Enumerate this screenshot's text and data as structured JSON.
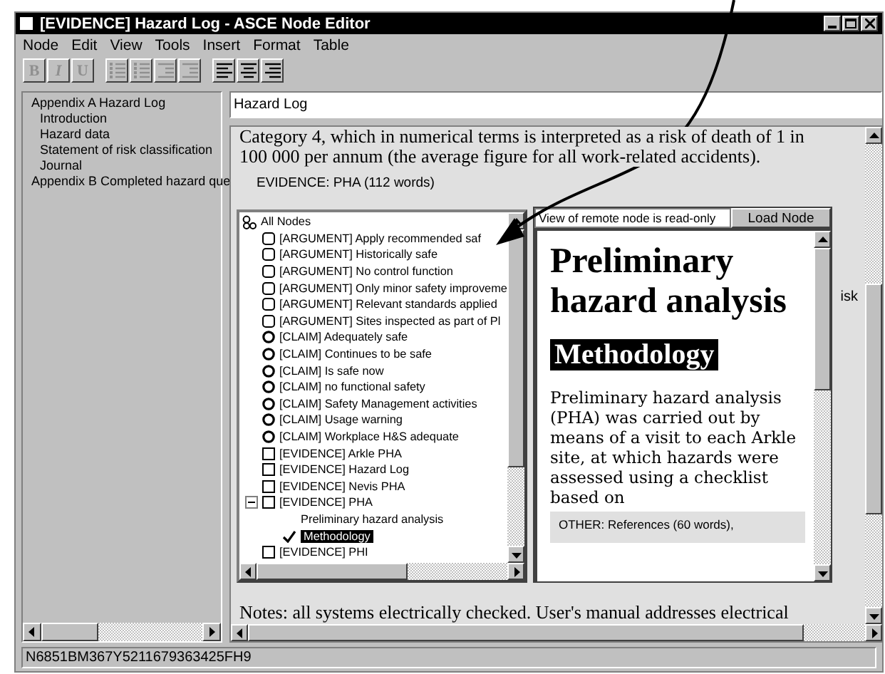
{
  "window": {
    "title": "[EVIDENCE] Hazard Log - ASCE Node Editor"
  },
  "menu": [
    "Node",
    "Edit",
    "View",
    "Tools",
    "Insert",
    "Format",
    "Table"
  ],
  "toolbar": [
    {
      "kind": "bold",
      "label": "B",
      "disabled": true
    },
    {
      "kind": "italic",
      "label": "I",
      "disabled": true
    },
    {
      "kind": "underline",
      "label": "U",
      "disabled": true
    },
    {
      "kind": "numbered-list",
      "disabled": true
    },
    {
      "kind": "bullet-list",
      "disabled": true
    },
    {
      "kind": "outdent",
      "disabled": true
    },
    {
      "kind": "indent",
      "disabled": true
    },
    {
      "kind": "align-left",
      "disabled": false
    },
    {
      "kind": "align-center",
      "disabled": false
    },
    {
      "kind": "align-right",
      "disabled": false
    }
  ],
  "outline": [
    {
      "label": "Appendix A Hazard Log",
      "children": [
        {
          "label": "Introduction"
        },
        {
          "label": "Hazard data"
        },
        {
          "label": "Statement of risk classification"
        },
        {
          "label": "Journal"
        }
      ]
    },
    {
      "label": "Appendix B Completed hazard que"
    }
  ],
  "title_field": {
    "value": "Hazard Log"
  },
  "document": {
    "lines": [
      "Category 4, which in numerical terms is interpreted as a risk of death of 1 in",
      "100 000 per annum (the average figure for all work-related accidents)."
    ],
    "embedded_node": "EVIDENCE: PHA (112 words)",
    "side_fragment": "isk",
    "bottom_line": "Notes: all systems electrically checked. User's manual addresses electrical"
  },
  "node_browser": {
    "root": "All Nodes",
    "items": [
      {
        "kind": "argument",
        "label": "[ARGUMENT] Apply recommended saf"
      },
      {
        "kind": "argument",
        "label": "[ARGUMENT] Historically safe"
      },
      {
        "kind": "argument",
        "label": "[ARGUMENT] No control function"
      },
      {
        "kind": "argument",
        "label": "[ARGUMENT] Only minor safety improveme"
      },
      {
        "kind": "argument",
        "label": "[ARGUMENT] Relevant standards applied"
      },
      {
        "kind": "argument",
        "label": "[ARGUMENT] Sites inspected as part of Pl"
      },
      {
        "kind": "claim",
        "label": "[CLAIM] Adequately safe"
      },
      {
        "kind": "claim",
        "label": "[CLAIM] Continues to be safe"
      },
      {
        "kind": "claim",
        "label": "[CLAIM] Is safe now"
      },
      {
        "kind": "claim",
        "label": "[CLAIM] no functional safety"
      },
      {
        "kind": "claim",
        "label": "[CLAIM] Safety Management activities"
      },
      {
        "kind": "claim",
        "label": "[CLAIM] Usage warning"
      },
      {
        "kind": "claim",
        "label": "[CLAIM] Workplace H&S adequate"
      },
      {
        "kind": "evidence",
        "label": "[EVIDENCE] Arkle PHA"
      },
      {
        "kind": "evidence",
        "label": "[EVIDENCE] Hazard Log"
      },
      {
        "kind": "evidence",
        "label": "[EVIDENCE] Nevis PHA"
      },
      {
        "kind": "evidence",
        "label": "[EVIDENCE] PHA",
        "expanded": true,
        "children": [
          {
            "label": "Preliminary hazard analysis",
            "selected": false
          },
          {
            "label": "Methodology",
            "selected": true
          }
        ]
      },
      {
        "kind": "evidence",
        "label": "[EVIDENCE] PHI"
      }
    ]
  },
  "remote_view": {
    "notice": "View of remote node is read-only",
    "button": "Load Node",
    "heading": "Preliminary hazard analysis",
    "subheading": "Methodology",
    "paragraph": "Preliminary hazard analysis (PHA) was carried out by means of a visit to each Arkle site, at which hazards were assessed using a checklist based on",
    "embedded_node": "OTHER: References (60 words),"
  },
  "status_bar": "N6851BM367Y5211679363425FH9"
}
